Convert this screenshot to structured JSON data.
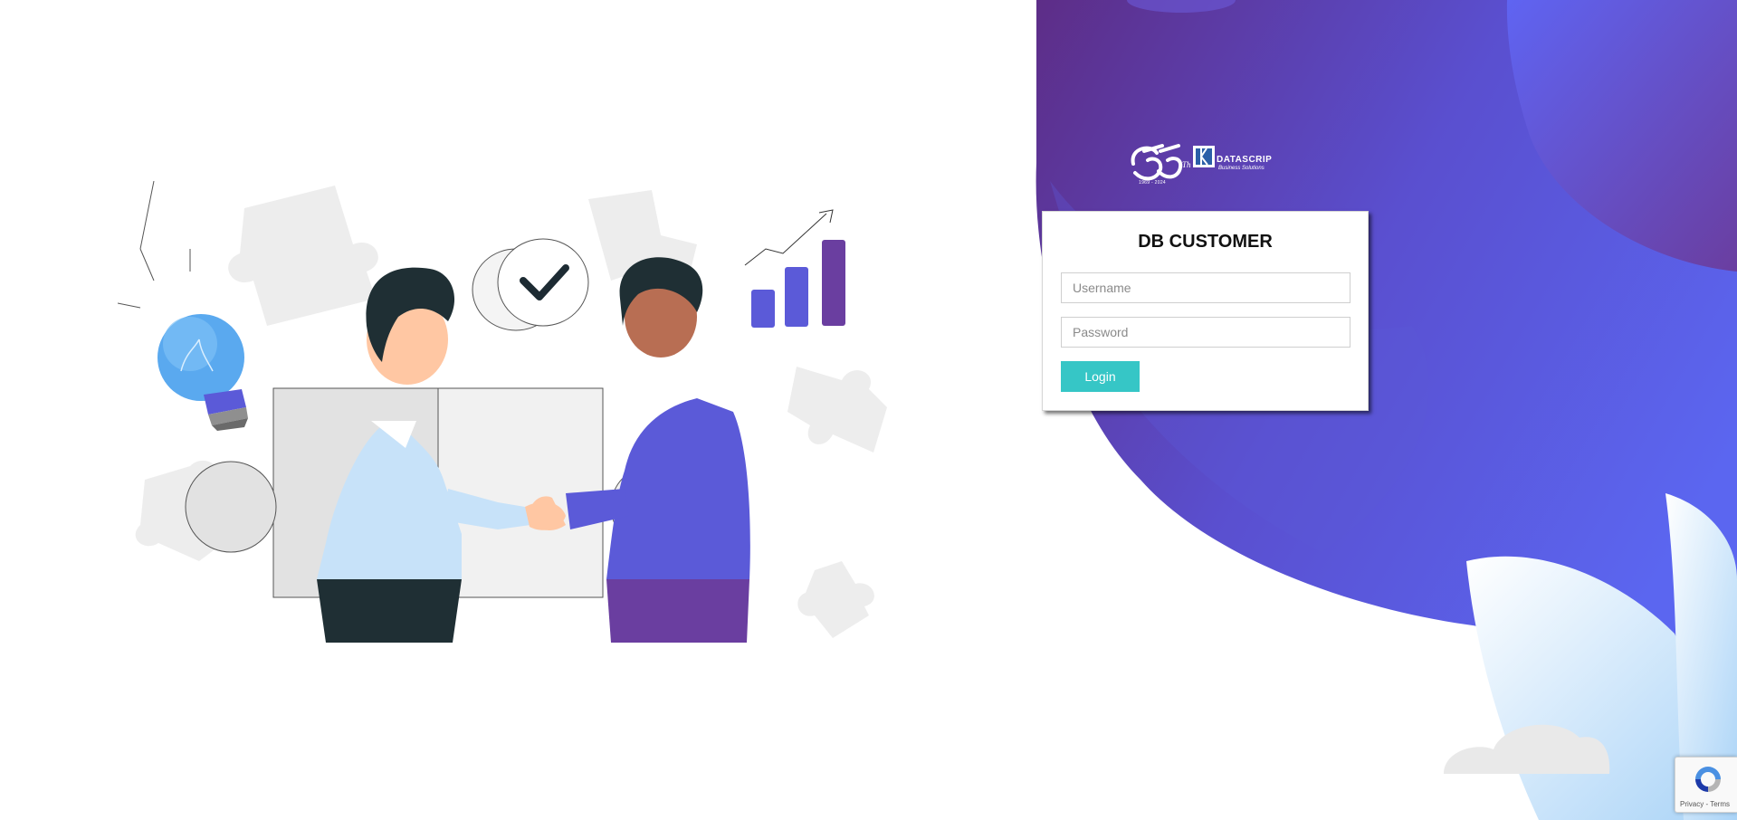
{
  "branding": {
    "anniversary_number": "55",
    "anniversary_suffix": "Th",
    "years": "1969 - 2024",
    "company": "DATASCRIP",
    "tagline": "Business Solutions"
  },
  "login": {
    "title": "DB CUSTOMER",
    "username_placeholder": "Username",
    "password_placeholder": "Password",
    "username_value": "",
    "password_value": "",
    "button_label": "Login"
  },
  "recaptcha": {
    "privacy": "Privacy",
    "separator": " - ",
    "terms": "Terms"
  },
  "colors": {
    "purple_dark": "#5d2d87",
    "purple_mid": "#5a4fcf",
    "blue": "#5b66f0",
    "button": "#36c6c6",
    "light_blue": "#bfe0fa"
  }
}
